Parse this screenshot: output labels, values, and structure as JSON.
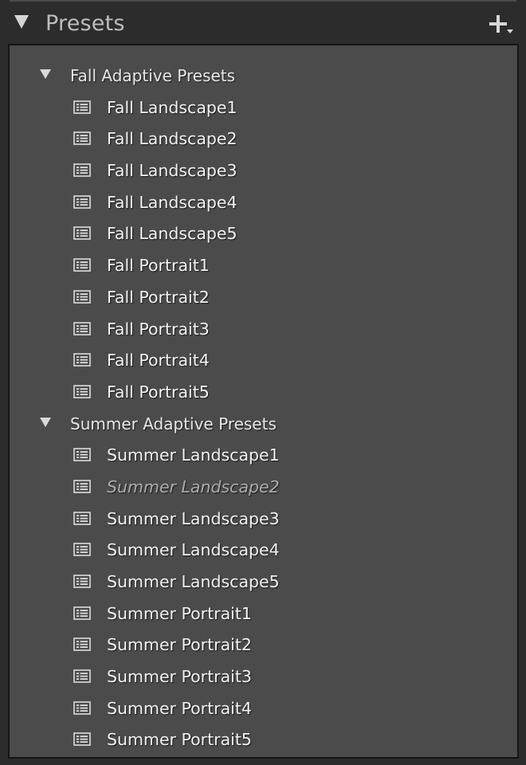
{
  "panel": {
    "title": "Presets",
    "add_icon": "plus-with-dropdown-icon"
  },
  "groups": [
    {
      "label": "Fall Adaptive Presets",
      "expanded": true,
      "items": [
        {
          "label": "Fall Landscape1",
          "muted": false
        },
        {
          "label": "Fall Landscape2",
          "muted": false
        },
        {
          "label": "Fall Landscape3",
          "muted": false
        },
        {
          "label": "Fall Landscape4",
          "muted": false
        },
        {
          "label": "Fall Landscape5",
          "muted": false
        },
        {
          "label": "Fall Portrait1",
          "muted": false
        },
        {
          "label": "Fall Portrait2",
          "muted": false
        },
        {
          "label": "Fall Portrait3",
          "muted": false
        },
        {
          "label": "Fall Portrait4",
          "muted": false
        },
        {
          "label": "Fall Portrait5",
          "muted": false
        }
      ]
    },
    {
      "label": "Summer Adaptive Presets",
      "expanded": true,
      "items": [
        {
          "label": "Summer Landscape1",
          "muted": false
        },
        {
          "label": "Summer Landscape2",
          "muted": true
        },
        {
          "label": "Summer Landscape3",
          "muted": false
        },
        {
          "label": "Summer Landscape4",
          "muted": false
        },
        {
          "label": "Summer Landscape5",
          "muted": false
        },
        {
          "label": "Summer Portrait1",
          "muted": false
        },
        {
          "label": "Summer Portrait2",
          "muted": false
        },
        {
          "label": "Summer Portrait3",
          "muted": false
        },
        {
          "label": "Summer Portrait4",
          "muted": false
        },
        {
          "label": "Summer Portrait5",
          "muted": false
        }
      ]
    }
  ],
  "colors": {
    "panel_bg": "#4b4b4b",
    "header_bg": "#2c2c2c",
    "text": "#f2f2f2",
    "muted_text": "#adadad"
  }
}
